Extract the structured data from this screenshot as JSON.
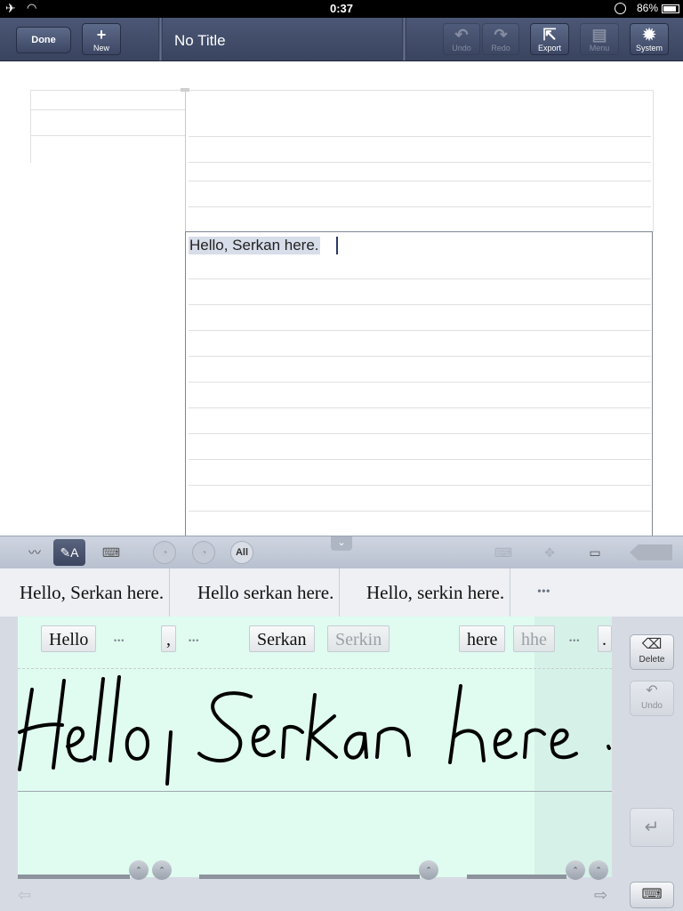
{
  "status_bar": {
    "time": "0:37",
    "battery": "86%",
    "icons": [
      "airplane-icon",
      "wifi-icon",
      "rotation-lock-icon",
      "battery-icon"
    ]
  },
  "toolbar": {
    "done_label": "Done",
    "new_label": "New",
    "title": "No Title",
    "undo_label": "Undo",
    "redo_label": "Redo",
    "export_label": "Export",
    "menu_label": "Menu",
    "system_label": "System"
  },
  "document": {
    "text": "Hello, Serkan here."
  },
  "input_toolbar": {
    "all_label": "All"
  },
  "candidates": [
    "Hello, Serkan here.",
    "Hello serkan here.",
    "Hello, serkin here.",
    "•••"
  ],
  "word_candidates": {
    "hello": "Hello",
    "comma": ",",
    "serkan": "Serkan",
    "serkin": "Serkin",
    "here": "here",
    "hhe": "hhe",
    "period": ".",
    "more": "•••"
  },
  "side_buttons": {
    "delete_label": "Delete",
    "undo_label": "Undo"
  }
}
